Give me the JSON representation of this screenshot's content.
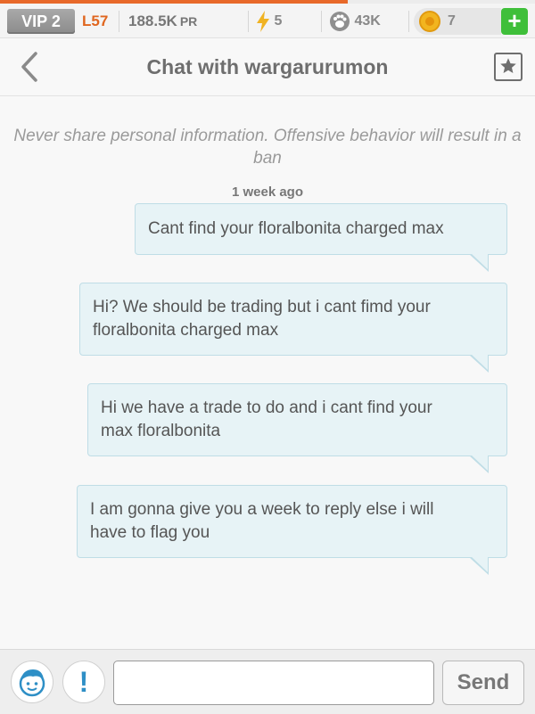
{
  "status_bar": {
    "vip_label": "VIP 2",
    "level": "L57",
    "power_rating_value": "188.5K",
    "power_rating_unit": "PR",
    "energy": "5",
    "paws": "43K",
    "coins": "7",
    "add_label": "+",
    "xp_progress": 0.65
  },
  "header": {
    "title": "Chat with wargarurumon"
  },
  "chat": {
    "warning": "Never share personal information. Offensive behavior will result in a ban",
    "timestamp": "1 week ago",
    "messages": [
      {
        "line1": "Cant find your floralbonita charged max",
        "line2": ""
      },
      {
        "line1": "Hi? We should be trading but i cant fimd your",
        "line2": "floralbonita charged max"
      },
      {
        "line1": "Hi we have a trade to do and i cant find your",
        "line2": "max floralbonita"
      },
      {
        "line1": "I am gonna give you a week to reply else i will",
        "line2": "have to flag you"
      }
    ]
  },
  "composer": {
    "value": "",
    "placeholder": "",
    "report_label": "!",
    "send_label": "Send"
  },
  "colors": {
    "accent_orange": "#e0661f",
    "bubble_bg": "#e7f3f6",
    "bubble_border": "#bfdde6",
    "add_green": "#3fbf3a",
    "coin_gold": "#f2b51f"
  },
  "icons": {
    "back": "chevron-left-icon",
    "favorite": "star-icon",
    "energy": "lightning-icon",
    "paws": "paw-icon",
    "coin": "coin-icon",
    "avatar": "boy-face-icon"
  }
}
